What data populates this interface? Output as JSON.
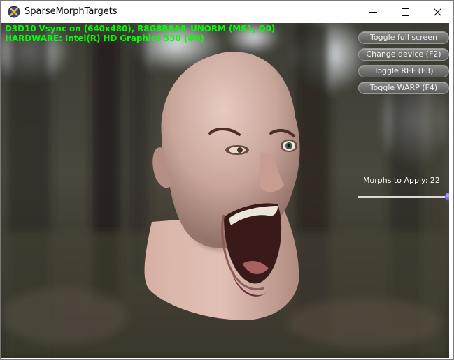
{
  "window": {
    "title": "SparseMorphTargets",
    "icon": "directx-x-icon"
  },
  "controls": {
    "minimize_icon": "minimize-icon",
    "maximize_icon": "maximize-icon",
    "close_icon": "close-icon"
  },
  "hud": {
    "line1": "D3D10 Vsync on (640x480), R8G8B8A8_UNORM (MS1, Q0)",
    "line2": "HARDWARE: Intel(R) HD Graphics 530 (#0)",
    "color": "#00ff00"
  },
  "buttons": [
    {
      "label": "Toggle full screen"
    },
    {
      "label": "Change device (F2)"
    },
    {
      "label": "Toggle REF (F3)"
    },
    {
      "label": "Toggle WARP (F4)"
    }
  ],
  "morphs": {
    "label": "Morphs to Apply: 22",
    "slider_fraction": 1.0
  }
}
